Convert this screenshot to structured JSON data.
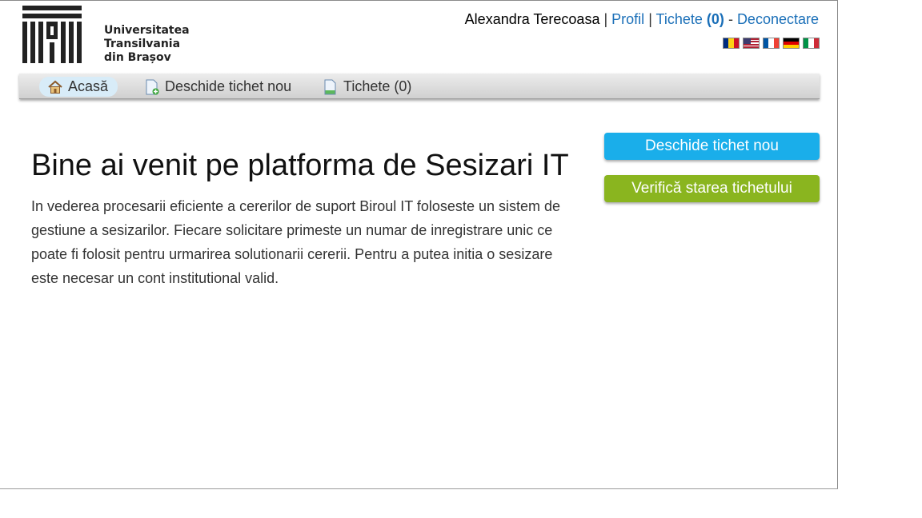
{
  "logo": {
    "line1": "Universitatea",
    "line2": "Transilvania",
    "line3": "din Brașov"
  },
  "user": {
    "name": "Alexandra Terecoasa",
    "profile_link": "Profil",
    "tickets_link": "Tichete",
    "tickets_count": "(0)",
    "logout_link": "Deconectare"
  },
  "languages": [
    "romanian-flag",
    "english-us-flag",
    "french-flag",
    "german-flag",
    "italian-flag"
  ],
  "nav": {
    "home": "Acasă",
    "new_ticket": "Deschide tichet nou",
    "tickets": "Tichete (0)"
  },
  "main": {
    "title": "Bine ai venit pe platforma de Sesizari IT",
    "intro": "In vederea procesarii eficiente a cererilor de suport Biroul IT foloseste un sistem de gestiune a sesizarilor. Fiecare solicitare primeste un numar de inregistrare unic ce poate fi folosit pentru urmarirea solutionarii cererii. Pentru a putea initia o sesizare este necesar un cont institutional valid."
  },
  "actions": {
    "open_ticket": "Deschide tichet nou",
    "check_status": "Verifică starea tichetului"
  },
  "colors": {
    "link": "#1a6fb8",
    "open_button": "#1aaeea",
    "check_button": "#8ab51f"
  }
}
